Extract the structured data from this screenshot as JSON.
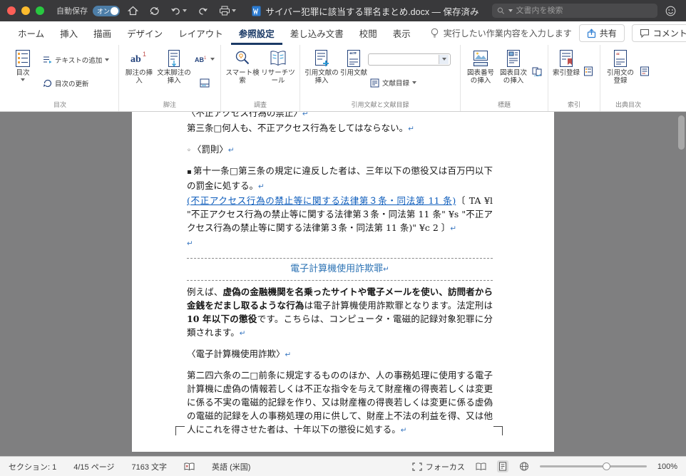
{
  "titlebar": {
    "autosave_label": "自動保存",
    "autosave_state": "オン",
    "doc_title": "サイバー犯罪に該当する罪名まとめ.docx — 保存済み",
    "search_placeholder": "文書内を検索"
  },
  "tabs": {
    "items": [
      "ホーム",
      "挿入",
      "描画",
      "デザイン",
      "レイアウト",
      "参照設定",
      "差し込み文書",
      "校閲",
      "表示"
    ],
    "tell_me": "実行したい作業内容を入力します",
    "share_label": "共有",
    "comments_label": "コメント"
  },
  "ribbon": {
    "toc_group": {
      "main": "目次",
      "add_text": "テキストの追加",
      "update": "目次の更新",
      "label": "目次"
    },
    "footnote_group": {
      "insert_footnote": "脚注の挿入",
      "insert_endnote": "文末脚注の挿入",
      "label": "脚注"
    },
    "research_group": {
      "smart_lookup": "スマート検索",
      "researcher": "リサーチツール",
      "label": "調査"
    },
    "citation_group": {
      "insert_citation": "引用文献の挿入",
      "citations": "引用文献",
      "bibliography": "文献目録",
      "label": "引用文献と文献目録"
    },
    "caption_group": {
      "insert_caption": "図表番号の挿入",
      "insert_tof": "図表目次の挿入",
      "label": "標題"
    },
    "index_group": {
      "mark_entry": "索引登録",
      "label": "索引"
    },
    "authority_group": {
      "mark_citation": "引用文の登録",
      "label": "出典目次"
    }
  },
  "document": {
    "pilcrow": "↵",
    "bullet_circle": "◦",
    "bullet_square": "▪",
    "heading_clipped": "〈不正アクセス行為の禁止〉",
    "art3": "第三条□何人も、不正アクセス行為をしてはならない。",
    "penalty": "〈罰則〉",
    "art11": "第十一条□第三条の規定に違反した者は、三年以下の懲役又は百万円以下の罰金に処する。",
    "cite_link": "(不正アクセス行為の禁止等に関する法律第３条・同法第 11 条)",
    "field_code": "〔 TA ¥l \"不正アクセス行為の禁止等に関する法律第３条・同法第 11 条\" ¥s \"不正アクセス行為の禁止等に関する法律第３条・同法第 11 条)\" ¥c 2 〕",
    "section_heading": "電子計算機使用詐欺罪",
    "fraud_r1": "例えば、",
    "fraud_r2": "虚偽の金融機関を名乗ったサイトや電子メールを使い、訪問者から金銭をだまし取るような行為",
    "fraud_r3": "は電子計算機使用詐欺罪となります。法定刑は ",
    "fraud_r4": "10 年以下の懲役",
    "fraud_r5": "です。こちらは、コンピュータ・電磁的記録対象犯罪に分類されます。",
    "sub_heading": "〈電子計算機使用詐欺〉",
    "art246": "第二四六条の二□前条に規定するもののほか、人の事務処理に使用する電子計算機に虚偽の情報若しくは不正な指令を与えて財産権の得喪若しくは変更に係る不実の電磁的記録を作り、又は財産権の得喪若しくは変更に係る虚偽の電磁的記録を人の事務処理の用に供して、財産上不法の利益を得、又は他人にこれを得させた者は、十年以下の懲役に処する。"
  },
  "status": {
    "section": "セクション: 1",
    "page_count": "4/15 ページ",
    "char_count": "7163 文字",
    "language": "英語 (米国)",
    "focus_label": "フォーカス",
    "zoom_level": "100%"
  }
}
